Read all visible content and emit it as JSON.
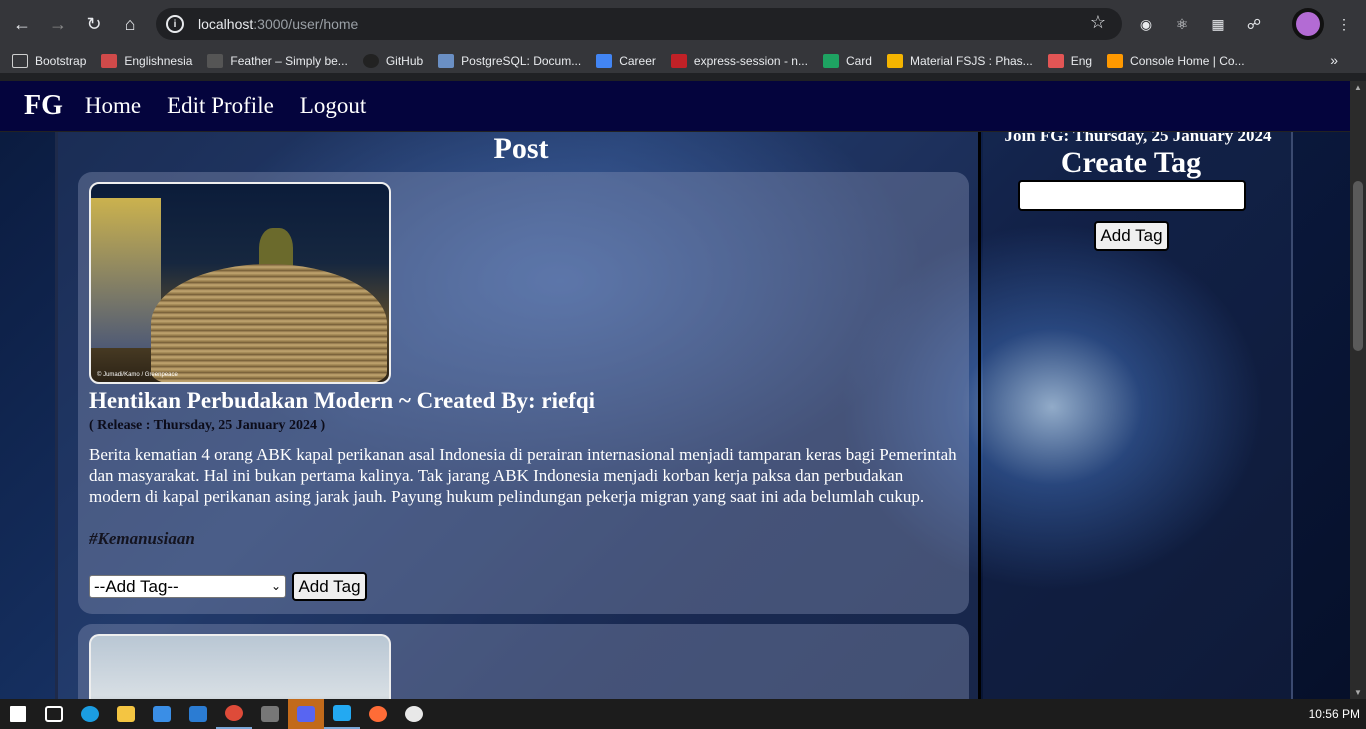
{
  "browser": {
    "url_host": "localhost",
    "url_path": ":3000/user/home",
    "bookmarks": [
      {
        "label": "Bootstrap",
        "color": "#cfcfcf"
      },
      {
        "label": "Englishnesia",
        "color": "#d04a4a"
      },
      {
        "label": "Feather – Simply be...",
        "color": "#8a8a8a"
      },
      {
        "label": "GitHub",
        "color": "#222222"
      },
      {
        "label": "PostgreSQL: Docum...",
        "color": "#6a8fc4"
      },
      {
        "label": "Career",
        "color": "#4285f4"
      },
      {
        "label": "express-session - n...",
        "color": "#c12127"
      },
      {
        "label": "Card",
        "color": "#1ea362"
      },
      {
        "label": "Material FSJS : Phas...",
        "color": "#f4b400"
      },
      {
        "label": "Eng",
        "color": "#e25555"
      },
      {
        "label": "Console Home | Co...",
        "color": "#ff9900"
      }
    ]
  },
  "navbar": {
    "brand": "FG",
    "links": [
      "Home",
      "Edit Profile",
      "Logout"
    ]
  },
  "main": {
    "heading": "Post",
    "post": {
      "image_credit": "© Jumadi/Kamo / Greenpeace",
      "title": "Hentikan Perbudakan Modern ~ Created By: riefqi",
      "release": "( Release : Thursday, 25 January 2024 )",
      "body": "Berita kematian 4 orang ABK kapal perikanan asal Indonesia di perairan internasional menjadi tamparan keras bagi Pemerintah dan masyarakat. Hal ini bukan pertama kalinya. Tak jarang ABK Indonesia menjadi korban kerja paksa dan perbudakan modern di kapal perikanan asing jarak jauh. Payung hukum pelindungan pekerja migran yang saat ini ada belumlah cukup.",
      "tag": "#Kemanusiaan",
      "select_value": "--Add Tag--",
      "add_tag_label": "Add Tag"
    }
  },
  "sidebar": {
    "join": "Join FG: Thursday, 25 January 2024",
    "create_tag_title": "Create Tag",
    "input_value": "",
    "add_tag_label": "Add Tag"
  },
  "taskbar": {
    "time": "10:56 PM"
  }
}
